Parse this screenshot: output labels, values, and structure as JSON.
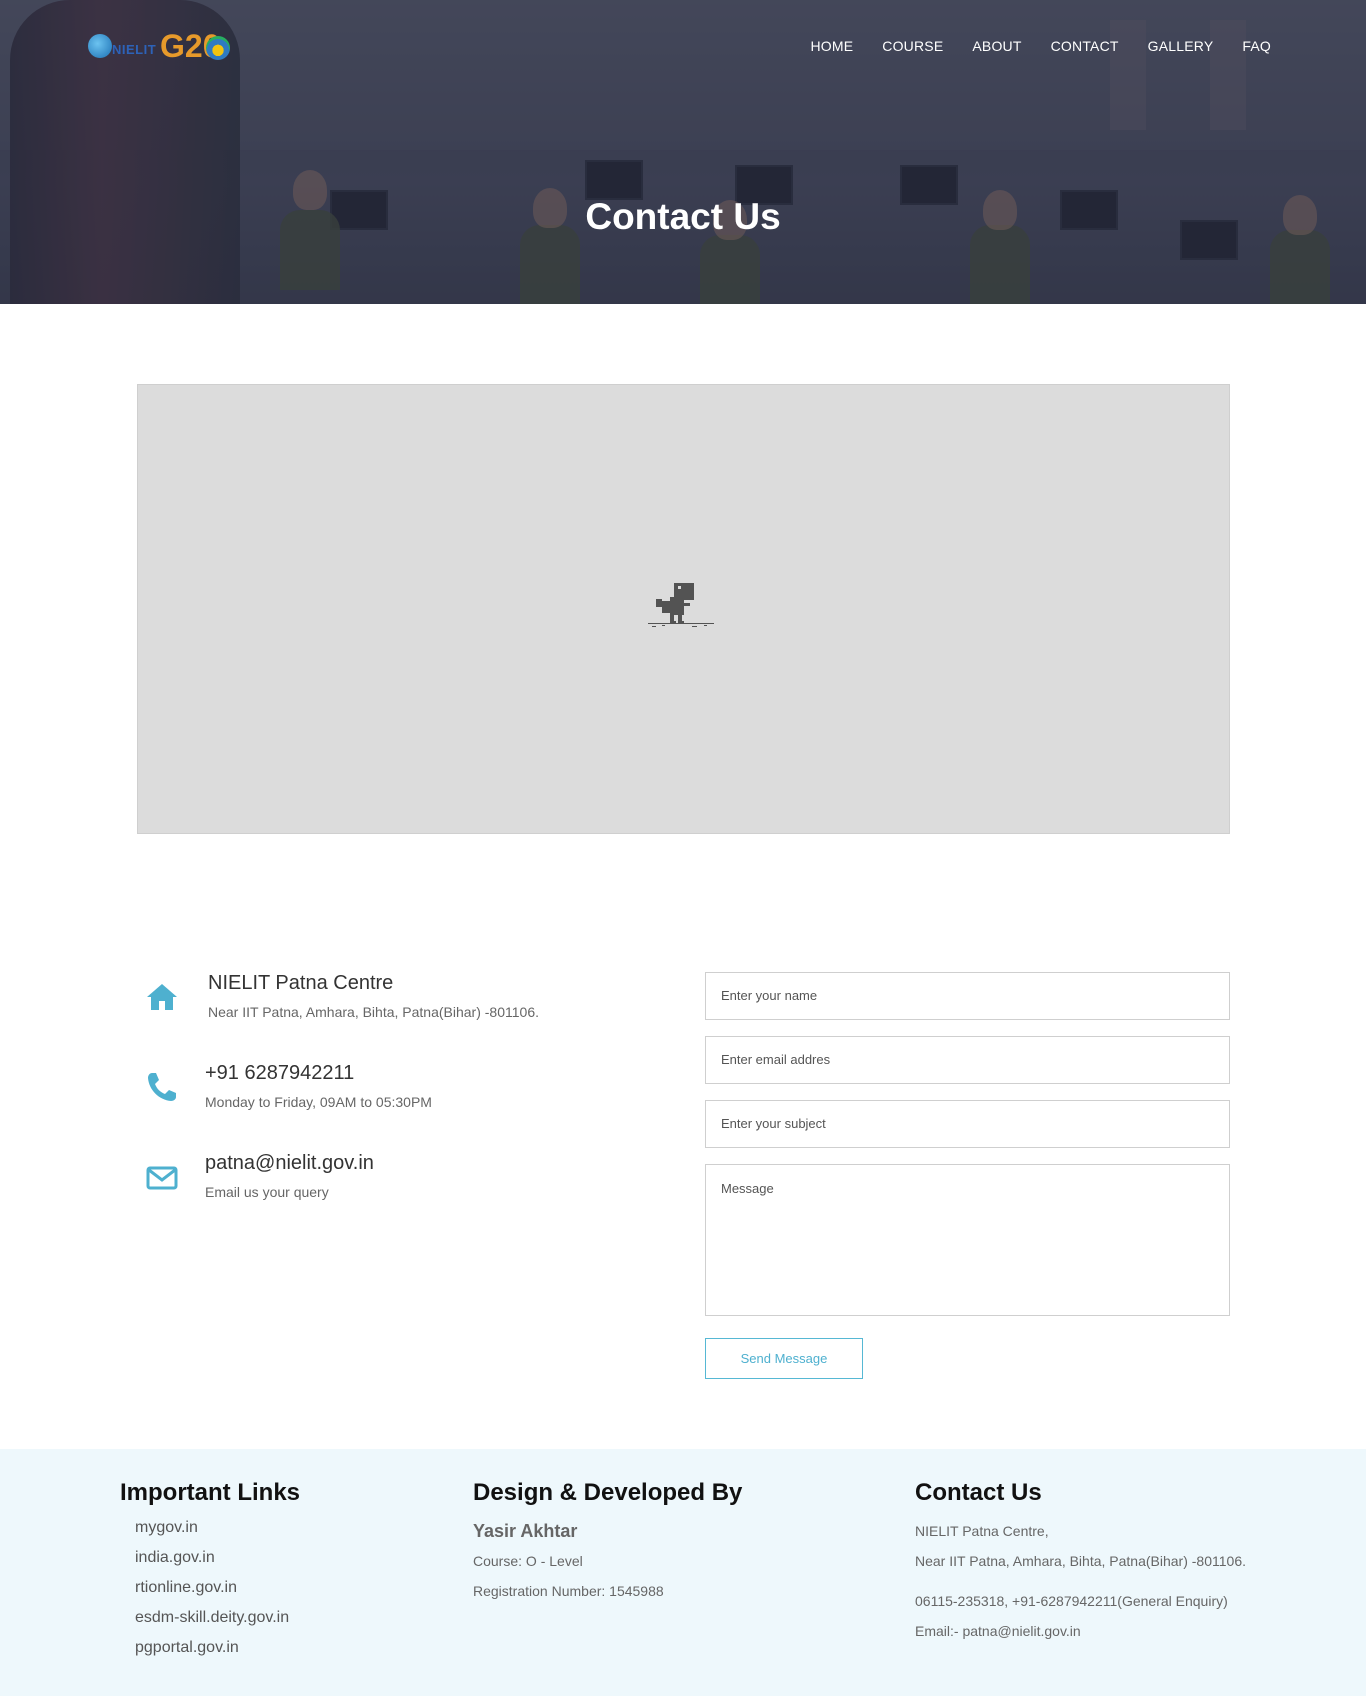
{
  "header": {
    "logo_text_nielit": "NIELIT",
    "logo_text_g20": "G20",
    "nav": [
      "HOME",
      "COURSE",
      "ABOUT",
      "CONTACT",
      "GALLERY",
      "FAQ"
    ],
    "hero_title": "Contact Us"
  },
  "map": {
    "icon": "dino-icon"
  },
  "contact_info": {
    "address_title": "NIELIT Patna Centre",
    "address_sub": "Near IIT Patna, Amhara, Bihta, Patna(Bihar) -801106.",
    "phone_title": "+91 6287942211",
    "phone_sub": "Monday to Friday, 09AM to 05:30PM",
    "email_title": "patna@nielit.gov.in",
    "email_sub": "Email us your query"
  },
  "form": {
    "name_placeholder": "Enter your name",
    "email_placeholder": "Enter email addres",
    "subject_placeholder": "Enter your subject",
    "message_placeholder": "Message",
    "send_label": "Send Message"
  },
  "footer": {
    "links_heading": "Important Links",
    "links": [
      "mygov.in",
      "india.gov.in",
      "rtionline.gov.in",
      "esdm-skill.deity.gov.in",
      "pgportal.gov.in"
    ],
    "dev_heading": "Design & Developed By",
    "dev_name": "Yasir Akhtar",
    "dev_course": "Course: O - Level",
    "dev_reg": "Registration Number: 1545988",
    "contact_heading": "Contact Us",
    "contact_line1": "NIELIT Patna Centre,",
    "contact_line2": "Near IIT Patna, Amhara, Bihta, Patna(Bihar) -801106.",
    "contact_line3": "06115-235318, +91-6287942211(General Enquiry)",
    "contact_line4": "Email:- patna@nielit.gov.in"
  },
  "colors": {
    "accent": "#4eb0cf",
    "footer_bg": "#eef8fc"
  }
}
